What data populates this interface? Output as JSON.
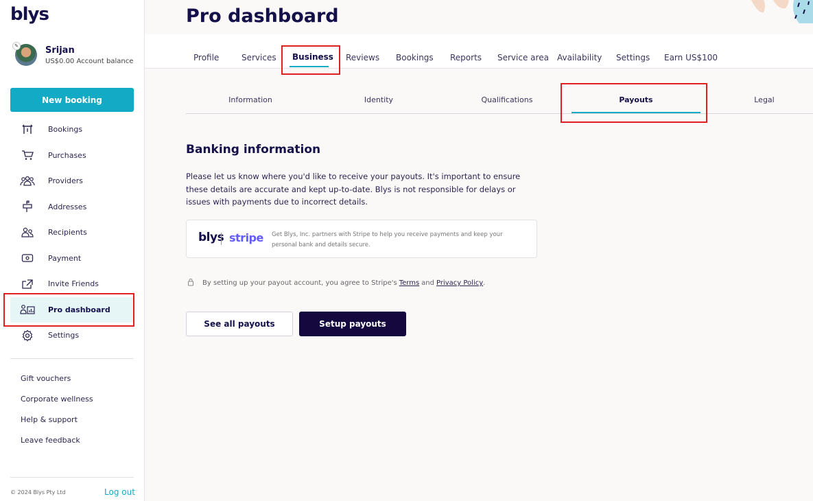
{
  "brand": {
    "logo": "blys"
  },
  "user": {
    "name": "Srijan",
    "balance": "US$0.00 Account balance"
  },
  "sidebar": {
    "new_booking": "New booking",
    "items": [
      {
        "label": "Bookings",
        "icon": "bookings-icon"
      },
      {
        "label": "Purchases",
        "icon": "cart-icon"
      },
      {
        "label": "Providers",
        "icon": "providers-icon"
      },
      {
        "label": "Addresses",
        "icon": "mailbox-icon"
      },
      {
        "label": "Recipients",
        "icon": "recipients-icon"
      },
      {
        "label": "Payment",
        "icon": "payment-icon"
      },
      {
        "label": "Invite Friends",
        "icon": "share-icon"
      },
      {
        "label": "Pro dashboard",
        "icon": "dashboard-icon",
        "active": true
      },
      {
        "label": "Settings",
        "icon": "gear-icon"
      }
    ],
    "links": [
      "Gift vouchers",
      "Corporate wellness",
      "Help & support",
      "Leave feedback"
    ],
    "copyright": "© 2024 Blys Pty Ltd",
    "logout": "Log out"
  },
  "page": {
    "title": "Pro dashboard"
  },
  "tabs": [
    "Profile",
    "Services",
    "Business",
    "Reviews",
    "Bookings",
    "Reports",
    "Service area",
    "Availability",
    "Settings",
    "Earn US$100"
  ],
  "active_tab": "Business",
  "subtabs": [
    "Information",
    "Identity",
    "Qualifications",
    "Payouts",
    "Legal"
  ],
  "active_subtab": "Payouts",
  "banking": {
    "title": "Banking information",
    "description": "Please let us know where you'd like to receive your payouts. It's important to ensure these details are accurate and kept up-to-date. Blys is not responsible for delays or issues with payments due to incorrect details.",
    "stripe_box": {
      "blys_logo": "blys",
      "stripe_logo": "stripe",
      "text": "Get Blys, Inc. partners with Stripe to help you receive payments and keep your personal bank and details secure."
    },
    "agreement": {
      "prefix": "By setting up your payout account, you agree to Stripe's",
      "terms": "Terms",
      "and": "and",
      "privacy": "Privacy Policy",
      "suffix": "."
    },
    "see_all_payouts": "See all payouts",
    "setup_payouts": "Setup payouts"
  },
  "colors": {
    "accent": "#12aac4",
    "navy": "#14104a",
    "highlight": "#e0201e",
    "stripe": "#635bff"
  }
}
